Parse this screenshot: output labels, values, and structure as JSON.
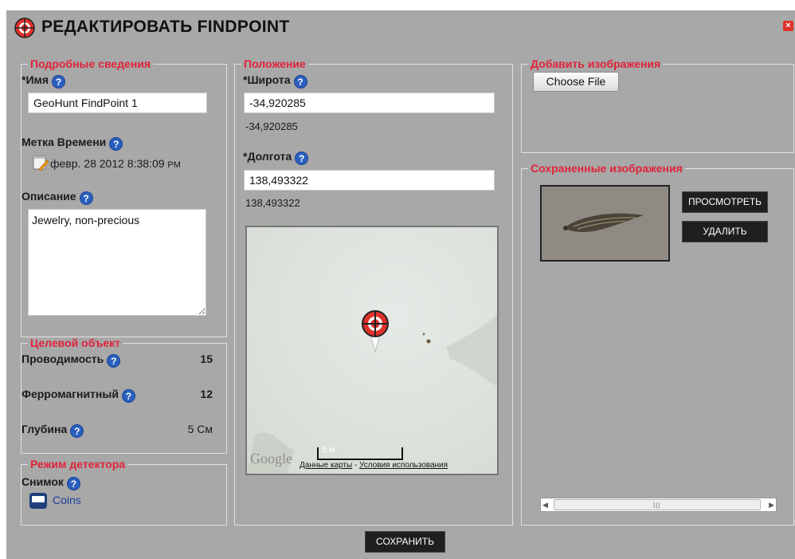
{
  "title": "РЕДАКТИРОВАТЬ FINDPOINT",
  "details": {
    "legend": "Подробные сведения",
    "name_label": "*Имя",
    "name_value": "GeoHunt FindPoint 1",
    "time_label": "Метка Времени",
    "time_value": "февр. 28 2012 8:38:09",
    "time_ampm": "PM",
    "desc_label": "Описание",
    "desc_value": "Jewelry, non-precious"
  },
  "target": {
    "legend": "Целевой объект",
    "rows": [
      {
        "label": "Проводимость",
        "value": "15"
      },
      {
        "label": "Ферромагнитный",
        "value": "12"
      },
      {
        "label": "Глубина",
        "value": "5 См"
      }
    ]
  },
  "detector": {
    "legend": "Режим детектора",
    "snapshot_label": "Снимок",
    "mode_value": "Coins"
  },
  "position": {
    "legend": "Положение",
    "lat_label": "*Широта",
    "lat_value": "-34,920285",
    "lat_readout": "-34,920285",
    "lon_label": "*Долгота",
    "lon_value": "138,493322",
    "lon_readout": "138,493322"
  },
  "map": {
    "scale_label": "5 м",
    "map_data_link": "Данные карты",
    "separator": " - ",
    "terms_link": "Условия использования",
    "logo": "Google"
  },
  "add_images": {
    "legend": "Добавить изображения",
    "choose_label": "Choose File"
  },
  "saved_images": {
    "legend": "Сохраненные изображения",
    "view_label": "ПРОСМОТРЕТЬ",
    "delete_label": "УДАЛИТЬ"
  },
  "save_label": "СОХРАНИТЬ",
  "colors": {
    "accent": "#e0233a",
    "help": "#2a5fbd",
    "panel_bg": "#a8a8a8"
  },
  "icons": {
    "help": "question-circle-icon",
    "calendar": "calendar-pencil-icon",
    "detector": "detector-mode-icon",
    "close": "close-icon",
    "marker": "findpoint-marker-icon"
  }
}
